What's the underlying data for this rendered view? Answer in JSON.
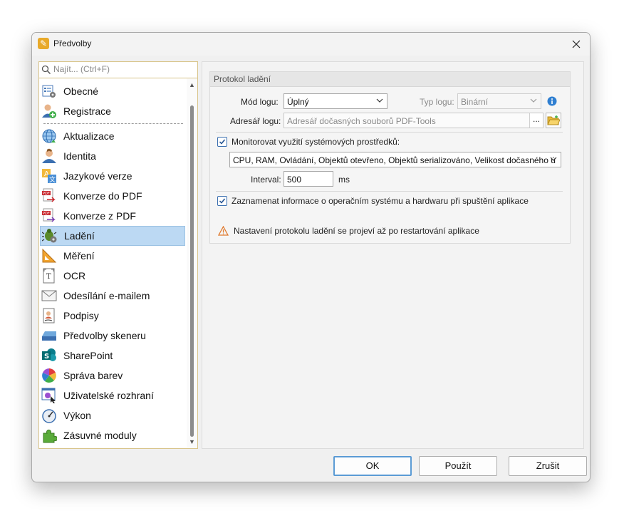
{
  "window": {
    "title": "Předvolby"
  },
  "search": {
    "placeholder": "Najít... (Ctrl+F)"
  },
  "sidebar": {
    "items": [
      {
        "label": "Obecné",
        "icon": "general-settings-icon"
      },
      {
        "label": "Registrace",
        "icon": "registration-user-icon"
      },
      {
        "label": "Aktualizace",
        "icon": "update-globe-icon"
      },
      {
        "label": "Identita",
        "icon": "identity-user-icon"
      },
      {
        "label": "Jazykové verze",
        "icon": "language-icon"
      },
      {
        "label": "Konverze do PDF",
        "icon": "convert-to-pdf-icon"
      },
      {
        "label": "Konverze z PDF",
        "icon": "convert-from-pdf-icon"
      },
      {
        "label": "Ladění",
        "icon": "debug-bug-icon",
        "selected": true
      },
      {
        "label": "Měření",
        "icon": "measure-ruler-icon"
      },
      {
        "label": "OCR",
        "icon": "ocr-icon"
      },
      {
        "label": "Odesílání e-mailem",
        "icon": "email-envelope-icon"
      },
      {
        "label": "Podpisy",
        "icon": "signature-icon"
      },
      {
        "label": "Předvolby skeneru",
        "icon": "scanner-icon"
      },
      {
        "label": "SharePoint",
        "icon": "sharepoint-icon"
      },
      {
        "label": "Správa barev",
        "icon": "color-management-icon"
      },
      {
        "label": "Uživatelské rozhraní",
        "icon": "user-interface-icon"
      },
      {
        "label": "Výkon",
        "icon": "performance-gauge-icon"
      },
      {
        "label": "Zásuvné moduly",
        "icon": "plugin-puzzle-icon"
      }
    ]
  },
  "debug": {
    "group_title": "Protokol ladění",
    "log_mode_label": "Mód logu:",
    "log_mode_value": "Úplný",
    "log_type_label": "Typ logu:",
    "log_type_value": "Binární",
    "log_dir_label": "Adresář logu:",
    "log_dir_placeholder": "Adresář dočasných souborů PDF-Tools",
    "browse_label": "...",
    "monitor_label": "Monitorovat využití systémových prostředků:",
    "monitor_checked": true,
    "monitor_value": "CPU, RAM, Ovládání, Objektů otevřeno, Objektů serializováno, Velikost dočasného ú",
    "interval_label": "Interval:",
    "interval_value": "500",
    "interval_unit": "ms",
    "record_label": "Zaznamenat informace o operačním systému a hardwaru při spuštění aplikace",
    "record_checked": true,
    "warning_text": "Nastavení protokolu ladění se projeví až po restartování aplikace"
  },
  "buttons": {
    "ok": "OK",
    "apply": "Použít",
    "cancel": "Zrušit"
  },
  "colors": {
    "selection": "#bcd9f3",
    "accent": "#5b9bd5",
    "warning": "#e07a2e",
    "info": "#2f7fd1"
  }
}
